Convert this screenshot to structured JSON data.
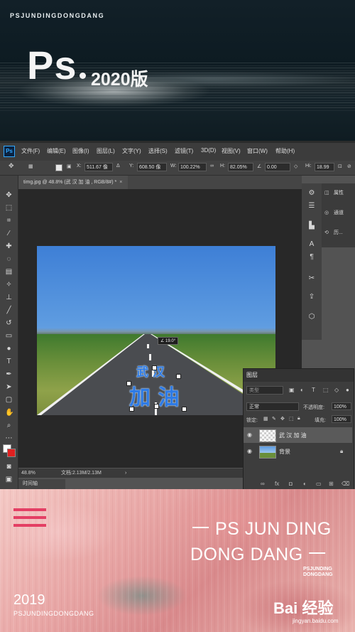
{
  "top_banner": {
    "brand": "PSJUNDINGDONGDANG",
    "title": "Ps",
    "version": "2020版"
  },
  "menu": {
    "logo": "Ps",
    "items": [
      "文件(F)",
      "编辑(E)",
      "图像(I)",
      "图层(L)",
      "文字(Y)",
      "选择(S)",
      "滤镜(T)",
      "3D(D)",
      "视图(V)",
      "窗口(W)",
      "帮助(H)"
    ]
  },
  "options_bar": {
    "x_label": "X:",
    "x_value": "511.67 像",
    "y_label": "Y:",
    "y_value": "608.50 像",
    "w_label": "W:",
    "w_value": "100.22%",
    "h_label": "H:",
    "h_value": "82.05%",
    "angle_value": "0.00",
    "hi_label": "Hi:",
    "hi_value": "18.99"
  },
  "document": {
    "tab_title": "timg.jpg @ 48.8% (武 汉 加 油 , RGB/8#) *",
    "close": "×",
    "rotation_badge": "∠ 19.0°",
    "text_line1": "武 汉",
    "text_line2": "加 油",
    "zoom": "48.8%",
    "doc_size": "文档:2.13M/2.13M"
  },
  "timeline_tab": "时间轴",
  "right_panel": {
    "items": [
      {
        "icon": "properties-icon",
        "label": "属性"
      },
      {
        "icon": "channels-icon",
        "label": "通道"
      },
      {
        "icon": "history-icon",
        "label": "历..."
      }
    ]
  },
  "layers_panel": {
    "tab": "图层",
    "search_placeholder": "类型",
    "blend_mode": "正常",
    "opacity_label": "不透明度:",
    "opacity_value": "100%",
    "lock_label": "锁定:",
    "fill_label": "填充:",
    "fill_value": "100%",
    "layers": [
      {
        "name": "武 汉 加 油",
        "type": "text",
        "visible": true,
        "selected": true
      },
      {
        "name": "背景",
        "type": "image",
        "visible": true,
        "selected": false,
        "locked": true
      }
    ]
  },
  "bottom_banner": {
    "line1": "一  PS JUN DING",
    "line2": "DONG DANG 一",
    "sub1": "PSJUNDING",
    "sub2": "DONGDANG",
    "year": "2019",
    "brand": "PSJUNDINGDONGDANG",
    "watermark": "Bai 经验",
    "watermark_url": "jingyan.baidu.com"
  },
  "colors": {
    "ps_accent": "#31a8ff",
    "canvas_text": "#2e7be6",
    "hamburger": "#e43f64",
    "background_color": "#e02020",
    "foreground_color": "#ffffff"
  }
}
